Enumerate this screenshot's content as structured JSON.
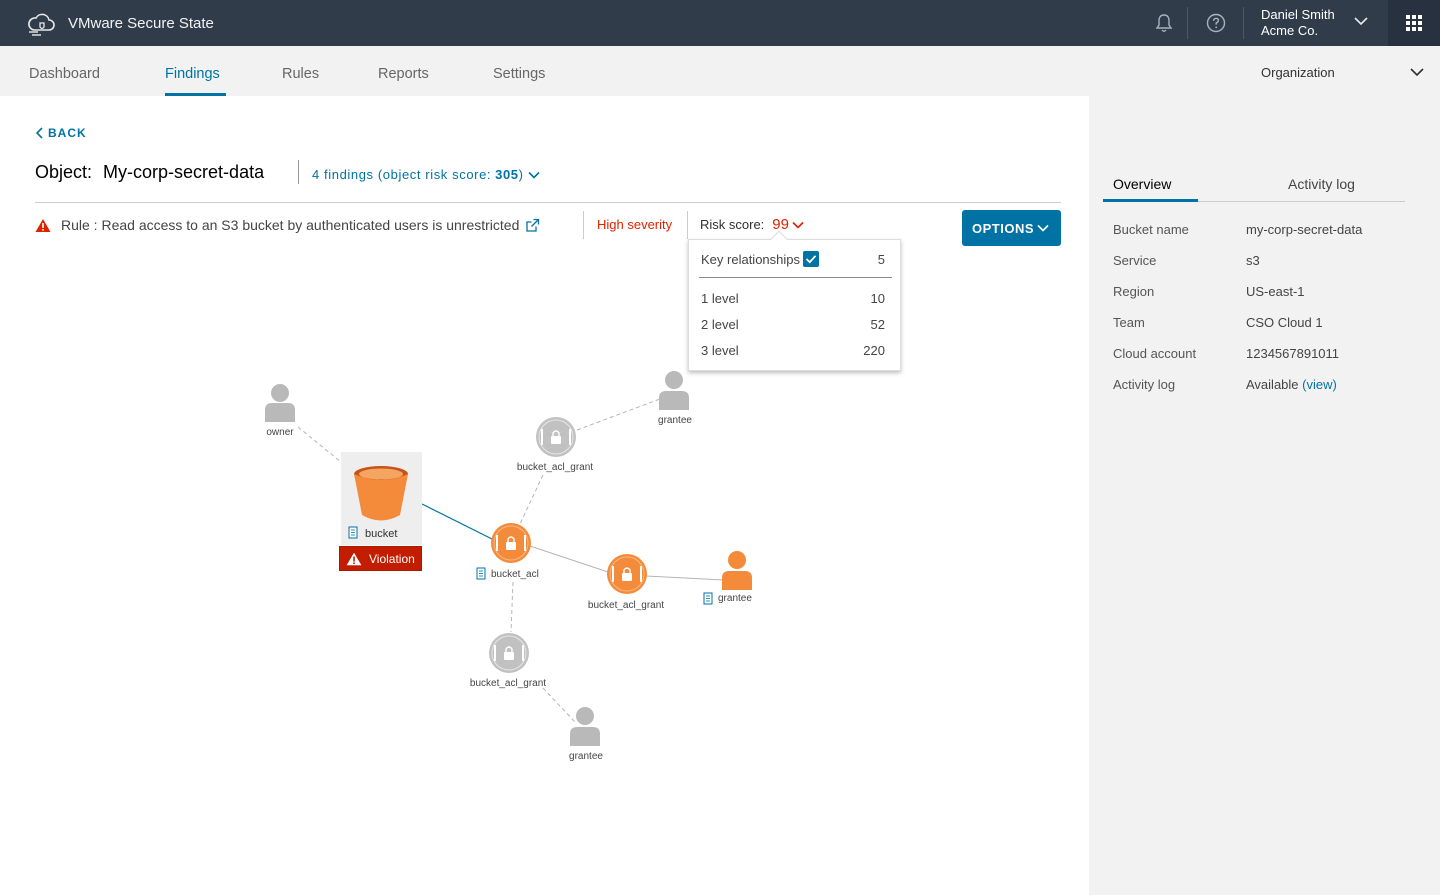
{
  "app": {
    "name": "VMware Secure State",
    "user_name": "Daniel Smith",
    "user_org": "Acme Co."
  },
  "nav": {
    "tabs": [
      {
        "label": "Dashboard"
      },
      {
        "label": "Findings"
      },
      {
        "label": "Rules"
      },
      {
        "label": "Reports"
      },
      {
        "label": "Settings"
      }
    ],
    "active_tab": "Findings",
    "org_label": "Organization"
  },
  "main": {
    "back_label": "BACK",
    "object_prefix": "Object:",
    "object_name": "My-corp-secret-data",
    "findings_text": "4 findings (object risk score:",
    "findings_score": "305",
    "findings_close": ")",
    "rule_text": "Rule : Read access to an S3 bucket by authenticated users is unrestricted",
    "severity": "High severity",
    "risk_label": "Risk score:",
    "risk_value": "99",
    "options_label": "OPTIONS"
  },
  "popup": {
    "header_label": "Key relationships",
    "header_checked": true,
    "header_value": "5",
    "rows": [
      {
        "label": "1 level",
        "value": "10"
      },
      {
        "label": "2 level",
        "value": "52"
      },
      {
        "label": "3 level",
        "value": "220"
      }
    ]
  },
  "graph": {
    "nodes": {
      "owner": "owner",
      "grantee_top": "grantee",
      "grant_top": "bucket_acl_grant",
      "bucket": "bucket",
      "bucket_acl": "bucket_acl",
      "grant_mid": "bucket_acl_grant",
      "grantee_mid": "grantee",
      "grant_bottom": "bucket_acl_grant",
      "grantee_bottom": "grantee"
    },
    "violation_label": "Violation",
    "colors": {
      "orange": "#f38b3b",
      "gray": "#b9b9b9",
      "blue_edge": "#0072a3",
      "violation": "#c21d00"
    }
  },
  "right_panel": {
    "tabs": [
      {
        "label": "Overview"
      },
      {
        "label": "Activity log"
      }
    ],
    "active_tab": "Overview",
    "details": [
      {
        "label": "Bucket name",
        "value": "my-corp-secret-data"
      },
      {
        "label": "Service",
        "value": "s3"
      },
      {
        "label": "Region",
        "value": "US-east-1"
      },
      {
        "label": "Team",
        "value": "CSO Cloud 1"
      },
      {
        "label": "Cloud account",
        "value": "1234567891011"
      },
      {
        "label": "Activity log",
        "value": "Available",
        "link": "(view)"
      }
    ]
  },
  "icons": {
    "logo": "cloud-shield-icon",
    "bell": "bell-icon",
    "help": "help-circle-icon",
    "apps": "apps-grid-icon",
    "warning": "warning-triangle-icon",
    "external": "external-link-icon"
  }
}
